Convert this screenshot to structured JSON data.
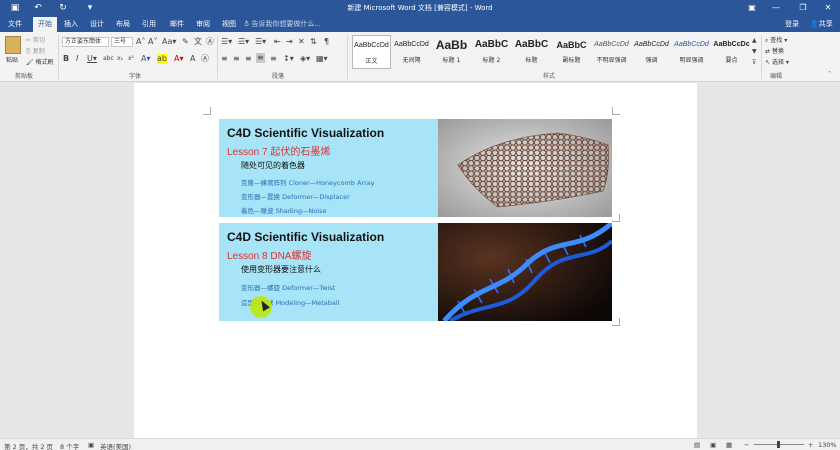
{
  "titlebar": {
    "title": "新建 Microsoft Word 文档 [兼容模式] - Word",
    "buttons": {
      "ribbon_options": "▣",
      "minimize": "—",
      "maximize": "❐",
      "close": "✕"
    }
  },
  "tabs": {
    "items": [
      "文件",
      "开始",
      "插入",
      "设计",
      "布局",
      "引用",
      "邮件",
      "审阅",
      "视图"
    ],
    "active": "开始",
    "tellme": "告诉我你想要做什么...",
    "signin": "登录",
    "share": "共享"
  },
  "ribbon": {
    "clipboard": {
      "paste": "粘贴",
      "cut": "剪切",
      "copy": "复制",
      "format_painter": "格式刷",
      "label": "剪贴板"
    },
    "font": {
      "font_name": "方正姿东簡体",
      "font_size": "三号",
      "label": "字体"
    },
    "paragraph": {
      "label": "段落"
    },
    "styles": {
      "label": "样式",
      "items": [
        {
          "preview": "AaBbCcDd",
          "name": "正文"
        },
        {
          "preview": "AaBbCcDd",
          "name": "无间隔"
        },
        {
          "preview": "AaBb",
          "name": "标题 1"
        },
        {
          "preview": "AaBbC",
          "name": "标题 2"
        },
        {
          "preview": "AaBbC",
          "name": "标题"
        },
        {
          "preview": "AaBbC",
          "name": "副标题"
        },
        {
          "preview": "AaBbCcDd",
          "name": "不明显强调"
        },
        {
          "preview": "AaBbCcDd",
          "name": "强调"
        },
        {
          "preview": "AaBbCcDd",
          "name": "明显强调"
        },
        {
          "preview": "AaBbCcDc",
          "name": "要点"
        }
      ]
    },
    "editing": {
      "find": "查找",
      "replace": "替换",
      "select": "选择",
      "label": "编辑"
    }
  },
  "document": {
    "cards": [
      {
        "title": "C4D Scientific Visualization",
        "lesson": "Lesson 7 起伏的石墨烯",
        "subtitle": "随处可见的着色器",
        "lines": [
          "克隆—蜂窝阵列 Cloner—Honeycomb Array",
          "变形器—置换 Deformer—Displacer",
          "着色—噪波 Shading—Noise"
        ],
        "image": "graphene-sheet"
      },
      {
        "title": "C4D Scientific Visualization",
        "lesson": "Lesson 8 DNA螺旋",
        "subtitle": "使用变形器要注意什么",
        "lines": [
          "变形器—螺旋 Deformer—Twist",
          "造型—融球 Modeling—Metaball"
        ],
        "image": "dna-helix"
      }
    ]
  },
  "statusbar": {
    "page": "第 2 页，共 2 页",
    "words": "8 个字",
    "language": "英语(美国)",
    "zoom": "130%"
  },
  "colors": {
    "word_blue": "#2b579a",
    "card_bg": "#a8e4f7",
    "lesson_red": "#e03030",
    "item_blue": "#2a6fb5"
  }
}
